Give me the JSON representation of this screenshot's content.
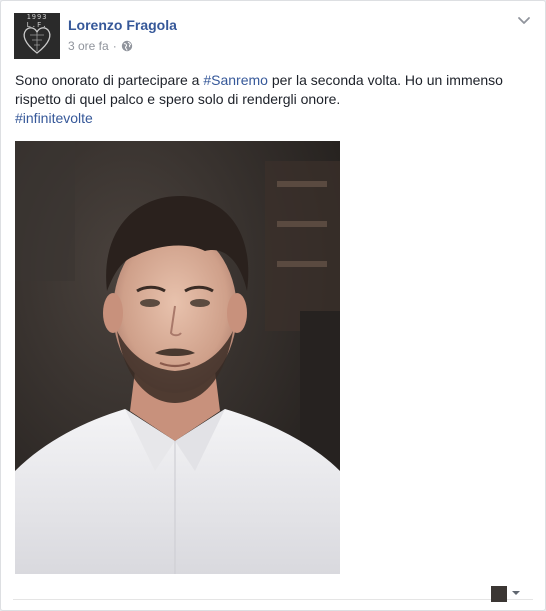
{
  "post": {
    "author": "Lorenzo Fragola",
    "time": "3 ore fa",
    "separator": "·",
    "privacy_icon": "globe-icon",
    "avatar_text": "1993 L.F.",
    "text_before": "Sono onorato di partecipare a ",
    "hashtag_1": "#Sanremo",
    "text_after": " per la seconda volta. Ho un immenso rispetto di quel palco e spero solo di rendergli onore.",
    "hashtag_2": "#infinitevolte",
    "photo_subject": "selfie-photo"
  },
  "colors": {
    "link": "#365899",
    "meta": "#90949c",
    "text": "#1d2129",
    "card_bg": "#ffffff",
    "page_bg": "#e9ebee"
  }
}
